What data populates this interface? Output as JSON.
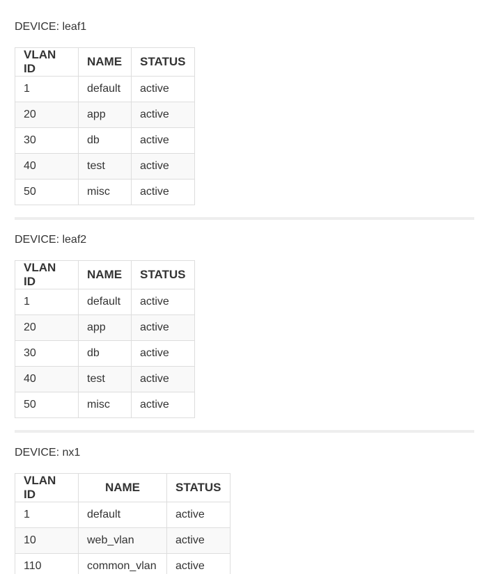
{
  "devices": [
    {
      "title": "DEVICE: leaf1",
      "headers": [
        "VLAN ID",
        "NAME",
        "STATUS"
      ],
      "rows": [
        [
          "1",
          "default",
          "active"
        ],
        [
          "20",
          "app",
          "active"
        ],
        [
          "30",
          "db",
          "active"
        ],
        [
          "40",
          "test",
          "active"
        ],
        [
          "50",
          "misc",
          "active"
        ]
      ]
    },
    {
      "title": "DEVICE: leaf2",
      "headers": [
        "VLAN ID",
        "NAME",
        "STATUS"
      ],
      "rows": [
        [
          "1",
          "default",
          "active"
        ],
        [
          "20",
          "app",
          "active"
        ],
        [
          "30",
          "db",
          "active"
        ],
        [
          "40",
          "test",
          "active"
        ],
        [
          "50",
          "misc",
          "active"
        ]
      ]
    },
    {
      "title": "DEVICE: nx1",
      "headers": [
        "VLAN ID",
        "NAME",
        "STATUS"
      ],
      "rows": [
        [
          "1",
          "default",
          "active"
        ],
        [
          "10",
          "web_vlan",
          "active"
        ],
        [
          "110",
          "common_vlan",
          "active"
        ]
      ]
    }
  ]
}
